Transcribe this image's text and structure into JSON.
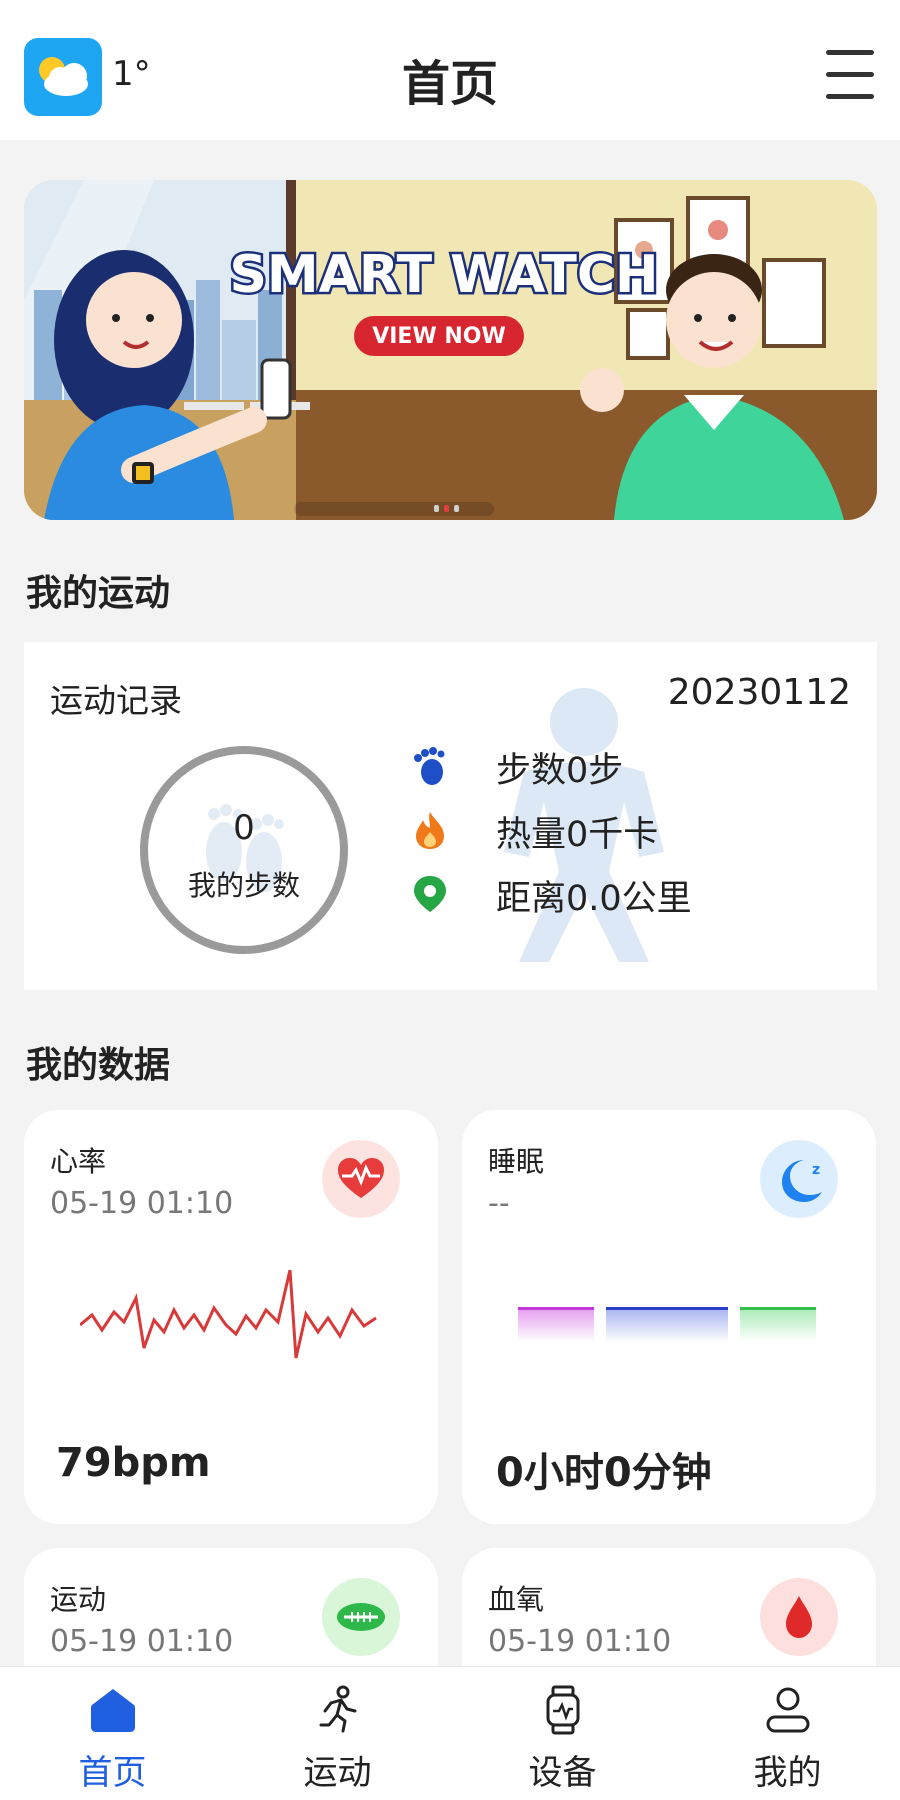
{
  "header": {
    "weather_icon": "partly-cloudy-icon",
    "temperature": "1°",
    "title": "首页",
    "menu_icon": "menu-icon"
  },
  "banner": {
    "headline": "SMART WATCH",
    "cta": "VIEW NOW",
    "carousel_pages": 3,
    "carousel_active": 2
  },
  "my_sport": {
    "section_title": "我的运动",
    "card_title": "运动记录",
    "date": "20230112",
    "steps_value": "0",
    "steps_label": "我的步数",
    "stats": [
      {
        "icon": "footprints-icon",
        "color": "#1e4fc7",
        "text": "步数0步"
      },
      {
        "icon": "flame-icon",
        "color": "#f07a1a",
        "text": "热量0千卡"
      },
      {
        "icon": "location-pin-icon",
        "color": "#27a645",
        "text": "距离0.0公里"
      }
    ]
  },
  "my_data": {
    "section_title": "我的数据",
    "cards": [
      {
        "title": "心率",
        "time": "05-19 01:10",
        "value": "79bpm",
        "icon": "heart-rate-icon",
        "icon_bg": "#fde3df",
        "icon_color": "#e63c3c"
      },
      {
        "title": "睡眠",
        "time": "--",
        "value": "0小时0分钟",
        "icon": "moon-sleep-icon",
        "icon_bg": "#dceefe",
        "icon_color": "#1e82f0"
      },
      {
        "title": "运动",
        "time": "05-19 01:10",
        "value": "",
        "icon": "football-icon",
        "icon_bg": "#d9f6d9",
        "icon_color": "#2fb84a"
      },
      {
        "title": "血氧",
        "time": "05-19 01:10",
        "value": "",
        "icon": "blood-drop-icon",
        "icon_bg": "#fde0de",
        "icon_color": "#e02a2a"
      }
    ]
  },
  "bottom_nav": [
    {
      "label": "首页",
      "icon": "home-icon",
      "active": true
    },
    {
      "label": "运动",
      "icon": "runner-icon",
      "active": false
    },
    {
      "label": "设备",
      "icon": "watch-icon",
      "active": false
    },
    {
      "label": "我的",
      "icon": "user-icon",
      "active": false
    }
  ],
  "colors": {
    "accent": "#1f5fe0",
    "heart_line": "#d83a3a",
    "sleep_deep": "#c438d8",
    "sleep_light": "#2a3fc8",
    "sleep_awake": "#2fbf4a"
  }
}
